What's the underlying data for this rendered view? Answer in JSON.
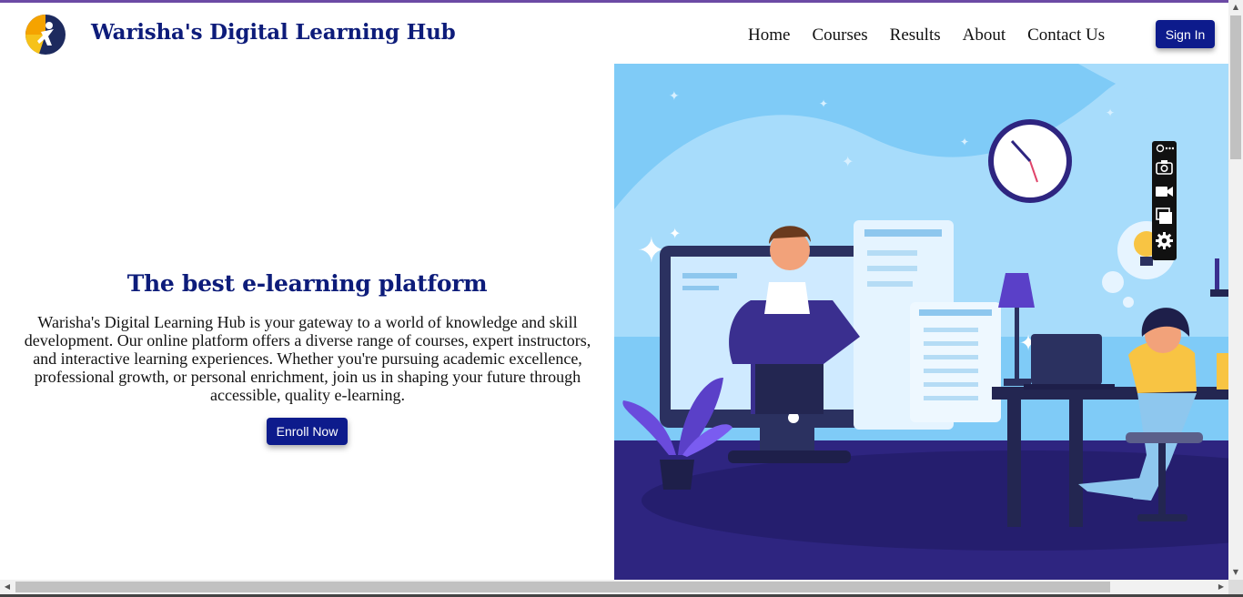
{
  "header": {
    "brand": "Warisha's Digital Learning Hub",
    "nav": [
      "Home",
      "Courses",
      "Results",
      "About",
      "Contact Us"
    ],
    "sign_in": "Sign In"
  },
  "hero": {
    "title": "The best e-learning platform",
    "text": "Warisha's Digital Learning Hub is your gateway to a world of knowledge and skill development. Our online platform offers a diverse range of courses, expert instructors, and interactive learning experiences. Whether you're pursuing academic excellence, professional growth, or personal enrichment, join us in shaping your future through accessible, quality e-learning.",
    "button": "Enroll Now"
  },
  "toolbar": {
    "icons": [
      "pin-icon",
      "more-icon",
      "camera-icon",
      "video-icon",
      "window-icon",
      "settings-icon"
    ]
  },
  "colors": {
    "brand": "#0d1c7a",
    "button": "#0d1b8c",
    "sky": "#7fcbf7",
    "floor": "#2e2580"
  }
}
